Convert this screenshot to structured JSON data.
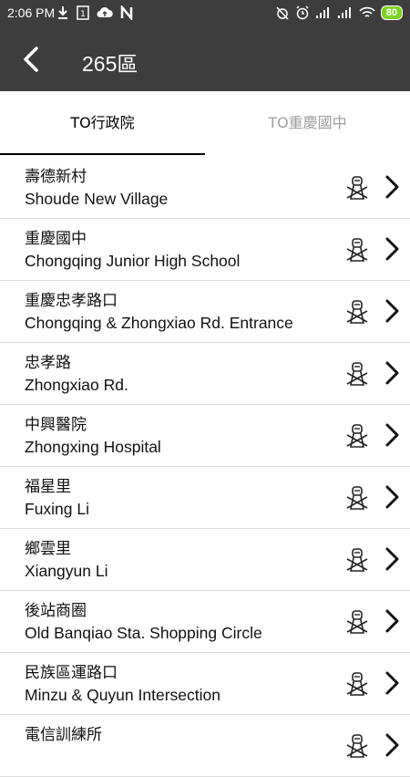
{
  "status_bar": {
    "time": "2:06 PM",
    "left_icons": [
      "download-icon",
      "sim-card-icon",
      "cloud-upload-icon",
      "n-notification-icon"
    ],
    "right_icons": [
      "alarm-off-icon",
      "alarm-clock-icon",
      "signal-icon",
      "signal-icon",
      "wifi-icon"
    ],
    "battery": "80",
    "battery_color": "#7ed321"
  },
  "app_bar": {
    "title": "265區",
    "background": "#3d3d3d"
  },
  "tabs": [
    {
      "label": "TO行政院",
      "active": true
    },
    {
      "label": "TO重慶國中",
      "active": false
    }
  ],
  "stops": [
    {
      "zh": "壽德新村",
      "en": "Shoude New Village"
    },
    {
      "zh": "重慶國中",
      "en": "Chongqing Junior High School"
    },
    {
      "zh": "重慶忠孝路口",
      "en": "Chongqing & Zhongxiao Rd. Entrance"
    },
    {
      "zh": "忠孝路",
      "en": "Zhongxiao Rd."
    },
    {
      "zh": "中興醫院",
      "en": "Zhongxing Hospital"
    },
    {
      "zh": "福星里",
      "en": "Fuxing Li"
    },
    {
      "zh": "鄉雲里",
      "en": "Xiangyun Li"
    },
    {
      "zh": "後站商圈",
      "en": "Old Banqiao Sta. Shopping Circle"
    },
    {
      "zh": "民族區運路口",
      "en": "Minzu & Quyun  Intersection"
    },
    {
      "zh": "電信訓練所",
      "en": ""
    }
  ]
}
